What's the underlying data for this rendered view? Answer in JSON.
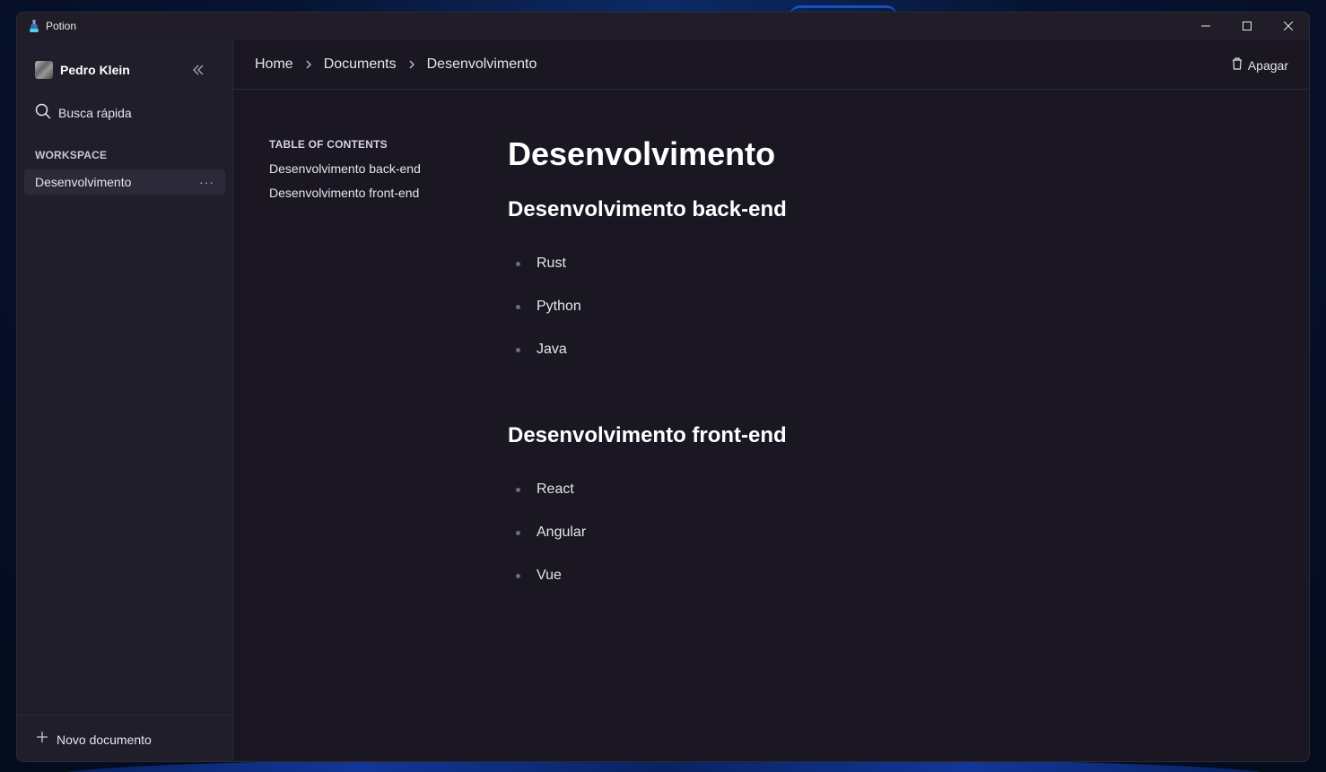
{
  "window": {
    "title": "Potion"
  },
  "sidebar": {
    "user_name": "Pedro Klein",
    "search_label": "Busca rápida",
    "workspace_label": "WORKSPACE",
    "items": [
      {
        "label": "Desenvolvimento",
        "more": "···"
      }
    ],
    "new_document_label": "Novo documento"
  },
  "breadcrumb": {
    "items": [
      "Home",
      "Documents",
      "Desenvolvimento"
    ]
  },
  "toolbar": {
    "delete_label": "Apagar"
  },
  "toc": {
    "title": "TABLE OF CONTENTS",
    "items": [
      "Desenvolvimento back-end",
      "Desenvolvimento front-end"
    ]
  },
  "document": {
    "title": "Desenvolvimento",
    "sections": [
      {
        "heading": "Desenvolvimento back-end",
        "items": [
          "Rust",
          "Python",
          "Java"
        ]
      },
      {
        "heading": "Desenvolvimento front-end",
        "items": [
          "React",
          "Angular",
          "Vue"
        ]
      }
    ]
  },
  "colors": {
    "background": "#1a1723",
    "sidebar": "#211e2b",
    "accent": "#ffffff"
  }
}
